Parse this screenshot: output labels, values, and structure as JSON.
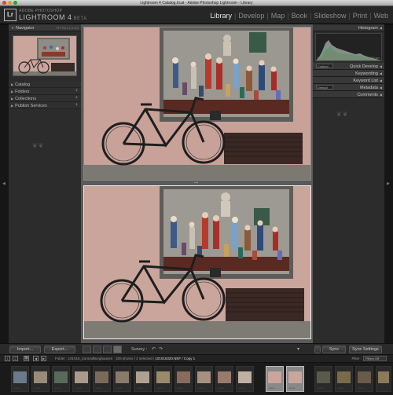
{
  "window": {
    "title": "Lightroom 4 Catalog.lrcat - Adobe Photoshop Lightroom - Library"
  },
  "identity": {
    "badge": "Lr",
    "brand": "ADOBE PHOTOSHOP",
    "product": "LIGHTROOM 4",
    "tag": "BETA"
  },
  "modules": [
    {
      "label": "Library",
      "active": true
    },
    {
      "label": "Develop"
    },
    {
      "label": "Map"
    },
    {
      "label": "Book"
    },
    {
      "label": "Slideshow"
    },
    {
      "label": "Print"
    },
    {
      "label": "Web"
    }
  ],
  "left_panel": {
    "navigator": {
      "label": "Navigator",
      "zoom_options": "FIT  FILL  1:1  3:1"
    },
    "sections": [
      {
        "label": "Catalog",
        "plus": false
      },
      {
        "label": "Folders",
        "plus": true
      },
      {
        "label": "Collections",
        "plus": true
      },
      {
        "label": "Publish Services",
        "plus": true
      }
    ],
    "import_label": "Import...",
    "export_label": "Export..."
  },
  "right_panel": {
    "histogram_label": "Histogram",
    "histogram_info": {
      "iso": "ISO 400",
      "focal": "40 mm",
      "aperture": "f / 5.6",
      "shutter": "1/50 sec"
    },
    "quick_develop": {
      "label": "Quick Develop",
      "preset": "Custom"
    },
    "keywording": "Keywording",
    "keyword_list": "Keyword List",
    "metadata": {
      "label": "Metadata",
      "preset": "Default"
    },
    "comments": "Comments",
    "sync_label": "Sync",
    "sync_settings_label": "Sync Settings"
  },
  "toolbar": {
    "survey_label": "Survey :"
  },
  "filmstrip": {
    "page_1": "1",
    "page_2": "2",
    "folder": "Folder : 101016_Zonnal/Burghausen",
    "count": "329 photos / 2 selected /",
    "filename": "101016320.NEF / Copy 1",
    "filter_label": "Filter :",
    "filter_value": "Filters Off"
  }
}
